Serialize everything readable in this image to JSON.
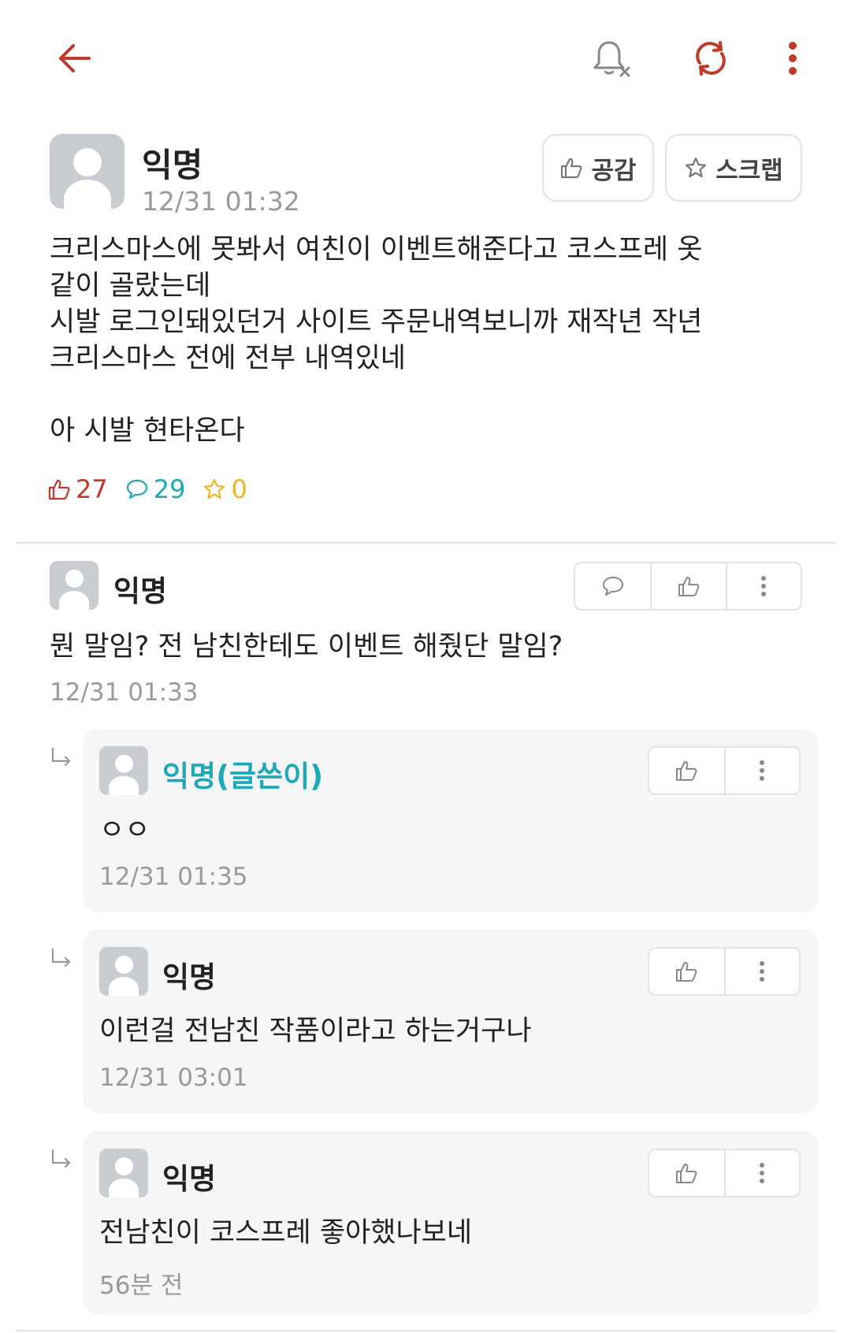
{
  "colors": {
    "accent": "#c0392b",
    "reply_author": "#1fa8b8",
    "comment_count": "#1fa8b8",
    "scrap_count": "#f0b429",
    "like_count": "#c0392b"
  },
  "icons": {
    "back": "back-arrow-icon",
    "notify": "bell-off-icon",
    "refresh": "refresh-icon",
    "more": "more-vertical-icon"
  },
  "post": {
    "author": "익명",
    "time": "12/31 01:32",
    "like_button": "공감",
    "scrap_button": "스크랩",
    "body": "크리스마스에 못봐서 여친이 이벤트해준다고 코스프레 옷\n같이 골랐는데\n시발 로그인돼있던거 사이트 주문내역보니까 재작년 작년\n크리스마스 전에 전부 내역있네\n\n아 시발 현타온다",
    "likes": "27",
    "comments": "29",
    "scraps": "0"
  },
  "comments": [
    {
      "author": "익명",
      "text": "뭔 말임? 전 남친한테도 이벤트 해줬단 말임?",
      "time": "12/31 01:33"
    }
  ],
  "replies": [
    {
      "author": "익명(글쓴이)",
      "text": "ㅇㅇ",
      "time": "12/31 01:35"
    },
    {
      "author": "익명",
      "text": "이런걸 전남친 작품이라고 하는거구나",
      "time": "12/31 03:01"
    },
    {
      "author": "익명",
      "text": "전남친이 코스프레 좋아했나보네",
      "time": "56분 전"
    }
  ]
}
